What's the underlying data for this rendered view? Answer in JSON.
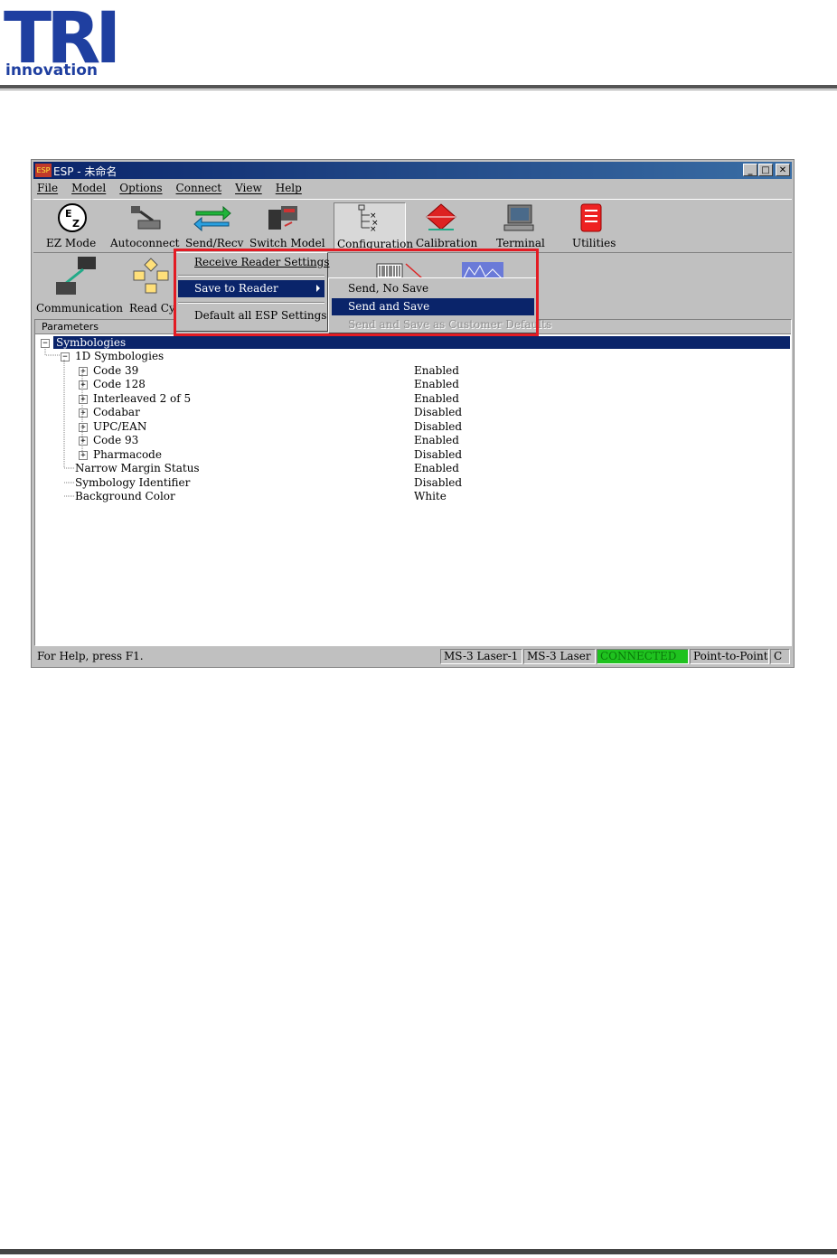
{
  "logo": {
    "brand": "TRI",
    "tagline": "innovation"
  },
  "window": {
    "title": "ESP - 未命名",
    "icon_text": "ESP",
    "controls": {
      "minimize": "_",
      "maximize": "□",
      "close": "✕"
    }
  },
  "menubar": [
    "File",
    "Model",
    "Options",
    "Connect",
    "View",
    "Help"
  ],
  "toolbar": {
    "ez_mode": "EZ Mode",
    "autoconnect": "Autoconnect",
    "send_recv": "Send/Recv",
    "switch_model": "Switch Model",
    "configuration": "Configuration",
    "calibration": "Calibration",
    "terminal": "Terminal",
    "utilities": "Utilities"
  },
  "toolbar2": {
    "communication": "Communication",
    "read_cycle": "Read Cyc"
  },
  "panel": {
    "header": "Parameters",
    "root": "Symbologies",
    "group": "1D Symbologies",
    "rows": [
      {
        "name": "Code 39",
        "value": "Enabled"
      },
      {
        "name": "Code 128",
        "value": "Enabled"
      },
      {
        "name": "Interleaved 2 of 5",
        "value": "Enabled"
      },
      {
        "name": "Codabar",
        "value": "Disabled"
      },
      {
        "name": "UPC/EAN",
        "value": "Disabled"
      },
      {
        "name": "Code 93",
        "value": "Enabled"
      },
      {
        "name": "Pharmacode",
        "value": "Disabled"
      }
    ],
    "leaves": [
      {
        "name": "Narrow Margin Status",
        "value": "Enabled"
      },
      {
        "name": "Symbology Identifier",
        "value": "Disabled"
      },
      {
        "name": "Background Color",
        "value": "White"
      }
    ]
  },
  "status": {
    "help": "For Help, press F1.",
    "model1": "MS-3 Laser-1",
    "model2": "MS-3 Laser",
    "connection": "CONNECTED",
    "mode": "Point-to-Point",
    "extra": "C"
  },
  "context_menu": {
    "receive": "Receive Reader Settings",
    "save_to_reader": "Save to Reader",
    "default_all": "Default all ESP Settings"
  },
  "submenu": {
    "send_no_save": "Send, No Save",
    "send_and_save": "Send and Save",
    "send_save_customer": "Send and Save as Customer Defaults"
  },
  "colors": {
    "accent": "#0a246a",
    "highlight_box": "#e31b23",
    "connected": "#1fc21f"
  }
}
